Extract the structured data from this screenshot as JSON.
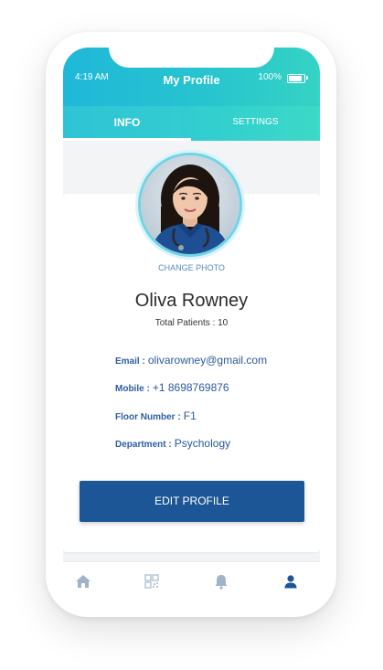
{
  "status_bar": {
    "time": "4:19 AM",
    "battery": "100%"
  },
  "header": {
    "title": "My Profile"
  },
  "tabs": [
    {
      "label": "INFO",
      "active": true
    },
    {
      "label": "SETTINGS",
      "active": false
    }
  ],
  "profile": {
    "change_photo_label": "CHANGE PHOTO",
    "name": "Oliva Rowney",
    "total_patients": "Total Patients : 10",
    "fields": {
      "email_label": "Email :",
      "email_value": "olivarowney@gmail.com",
      "mobile_label": "Mobile :",
      "mobile_value": "+1 8698769876",
      "floor_label": "Floor Number :",
      "floor_value": "F1",
      "department_label": "Department :",
      "department_value": "Psychology"
    },
    "edit_button_label": "EDIT PROFILE"
  },
  "bottom_nav": [
    {
      "icon": "home-icon",
      "active": false
    },
    {
      "icon": "qr-code-icon",
      "active": false
    },
    {
      "icon": "bell-icon",
      "active": false
    },
    {
      "icon": "user-icon",
      "active": true
    }
  ],
  "colors": {
    "header_gradient_start": "#1fb8d9",
    "header_gradient_end": "#35d3c4",
    "button": "#1c5696",
    "text_blue": "#2e5da6",
    "nav_inactive": "#9fb4c8",
    "nav_active": "#1c5696"
  }
}
